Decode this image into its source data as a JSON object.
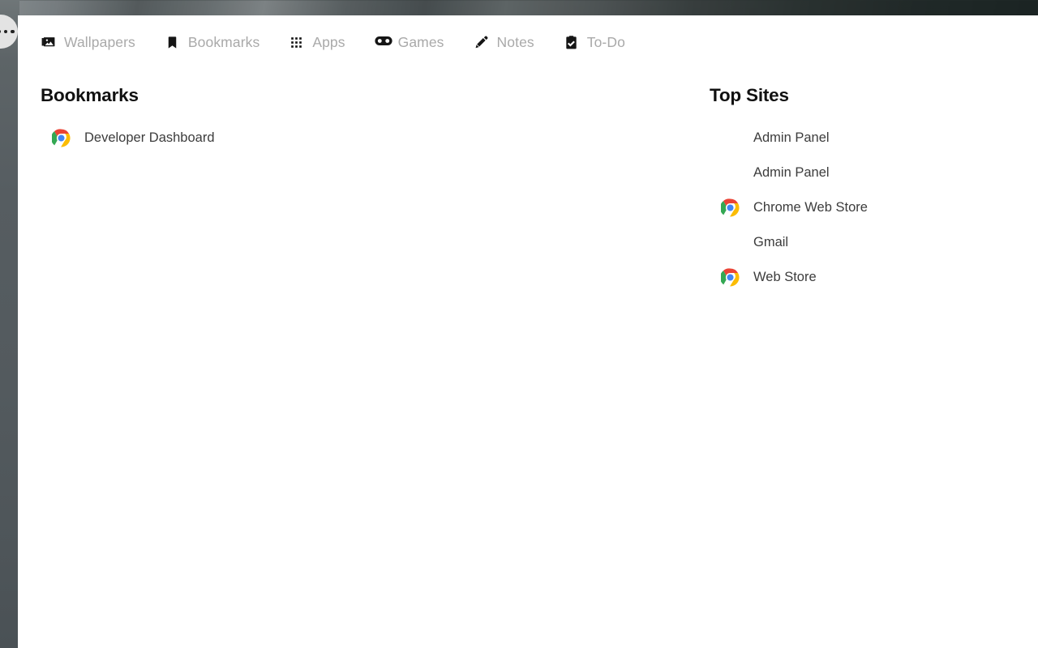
{
  "more_button": {
    "name": "more-options",
    "dots": 3
  },
  "nav": {
    "items": [
      {
        "label": "Wallpapers",
        "icon": "images-icon",
        "key": "wallpapers"
      },
      {
        "label": "Bookmarks",
        "icon": "bookmark-icon",
        "key": "bookmarks"
      },
      {
        "label": "Apps",
        "icon": "grid-apps-icon",
        "key": "apps"
      },
      {
        "label": "Games",
        "icon": "gamepad-icon",
        "key": "games"
      },
      {
        "label": "Notes",
        "icon": "pencil-icon",
        "key": "notes"
      },
      {
        "label": "To-Do",
        "icon": "clipboard-check-icon",
        "key": "todo"
      }
    ]
  },
  "bookmarks": {
    "title": "Bookmarks",
    "items": [
      {
        "label": "Developer Dashboard",
        "icon": "chrome-icon"
      }
    ]
  },
  "top_sites": {
    "title": "Top Sites",
    "items": [
      {
        "label": "Admin Panel",
        "icon": "none"
      },
      {
        "label": "Admin Panel",
        "icon": "none"
      },
      {
        "label": "Chrome Web Store",
        "icon": "chrome-icon"
      },
      {
        "label": "Gmail",
        "icon": "none"
      },
      {
        "label": "Web Store",
        "icon": "chrome-icon"
      }
    ]
  },
  "colors": {
    "nav_label": "#a9a9a9",
    "heading": "#111111",
    "entry_label": "#3c3c3c",
    "panel_background": "#ffffff",
    "backdrop_left": "#545b5f",
    "more_button_background": "#e3e3e3",
    "chrome_red": "#ea4335",
    "chrome_yellow": "#fbbc05",
    "chrome_green": "#34a853",
    "chrome_blue": "#4285f4"
  }
}
